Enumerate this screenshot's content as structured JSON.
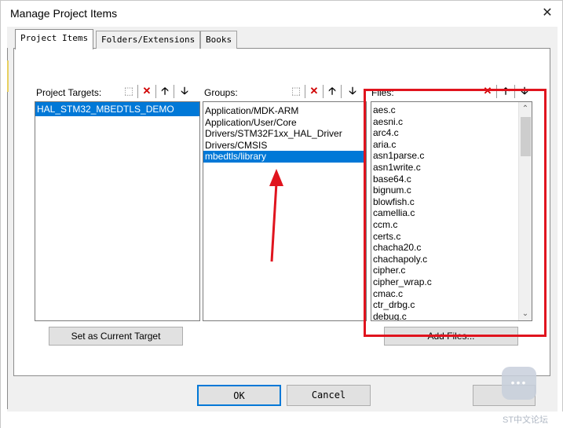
{
  "window": {
    "title": "Manage Project Items",
    "close_glyph": "✕"
  },
  "tabs": [
    {
      "label": "Project Items",
      "active": true
    },
    {
      "label": "Folders/Extensions",
      "active": false
    },
    {
      "label": "Books",
      "active": false
    }
  ],
  "targets": {
    "label": "Project Targets:",
    "items": [
      "HAL_STM32_MBEDTLS_DEMO"
    ],
    "selected_index": 0,
    "set_current_button": "Set as Current Target"
  },
  "groups": {
    "label": "Groups:",
    "items": [
      "Application/MDK-ARM",
      "Application/User/Core",
      "Drivers/STM32F1xx_HAL_Driver",
      "Drivers/CMSIS",
      "mbedtls/library"
    ],
    "selected_index": 4
  },
  "files": {
    "label": "Files:",
    "items": [
      "aes.c",
      "aesni.c",
      "arc4.c",
      "aria.c",
      "asn1parse.c",
      "asn1write.c",
      "base64.c",
      "bignum.c",
      "blowfish.c",
      "camellia.c",
      "ccm.c",
      "certs.c",
      "chacha20.c",
      "chachapoly.c",
      "cipher.c",
      "cipher_wrap.c",
      "cmac.c",
      "ctr_drbg.c",
      "debug.c"
    ],
    "add_files_button": "Add Files..."
  },
  "toolbar_icons": {
    "new": "new-item-icon",
    "delete": "delete-icon",
    "up": "move-up-icon",
    "down": "move-down-icon",
    "new_glyph": "⬚",
    "delete_glyph": "✕",
    "up_glyph": "🡡",
    "down_glyph": "🡣"
  },
  "scroll_glyphs": {
    "up": "⌃",
    "down": "⌄"
  },
  "footer": {
    "ok": "OK",
    "cancel": "Cancel"
  },
  "watermark": {
    "text": "ST中文论坛",
    "dots": "•••"
  },
  "colors": {
    "selection": "#0078d7",
    "highlight_frame": "#e0141e",
    "arrow": "#e0141e",
    "delete_icon": "#d00000"
  }
}
